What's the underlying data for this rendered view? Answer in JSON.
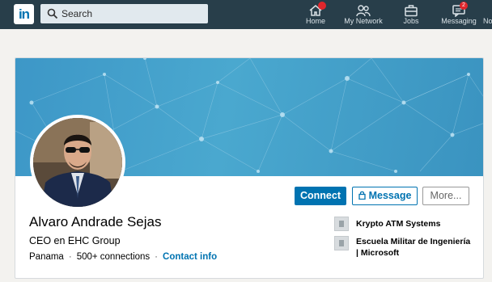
{
  "nav": {
    "logo_text": "in",
    "search_placeholder": "Search",
    "items": [
      {
        "label": "Home",
        "icon": "home-icon",
        "badge": ""
      },
      {
        "label": "My Network",
        "icon": "my-network-icon",
        "badge": ""
      },
      {
        "label": "Jobs",
        "icon": "jobs-icon",
        "badge": ""
      },
      {
        "label": "Messaging",
        "icon": "messaging-icon",
        "badge": "2"
      },
      {
        "label": "No",
        "icon": "",
        "badge": ""
      }
    ]
  },
  "profile": {
    "name": "Alvaro Andrade Sejas",
    "headline": "CEO en EHC Group",
    "location": "Panama",
    "connections": "500+ connections",
    "contact_label": "Contact info",
    "buttons": {
      "connect": "Connect",
      "message": "Message",
      "more": "More..."
    },
    "side": [
      {
        "text": "Krypto ATM Systems"
      },
      {
        "text_line1": "Escuela Militar de Ingeniería",
        "text_line2": "| Microsoft"
      }
    ]
  },
  "colors": {
    "nav_bg": "#283e4a",
    "brand_blue": "#0073b1",
    "badge_red": "#e0262c"
  }
}
